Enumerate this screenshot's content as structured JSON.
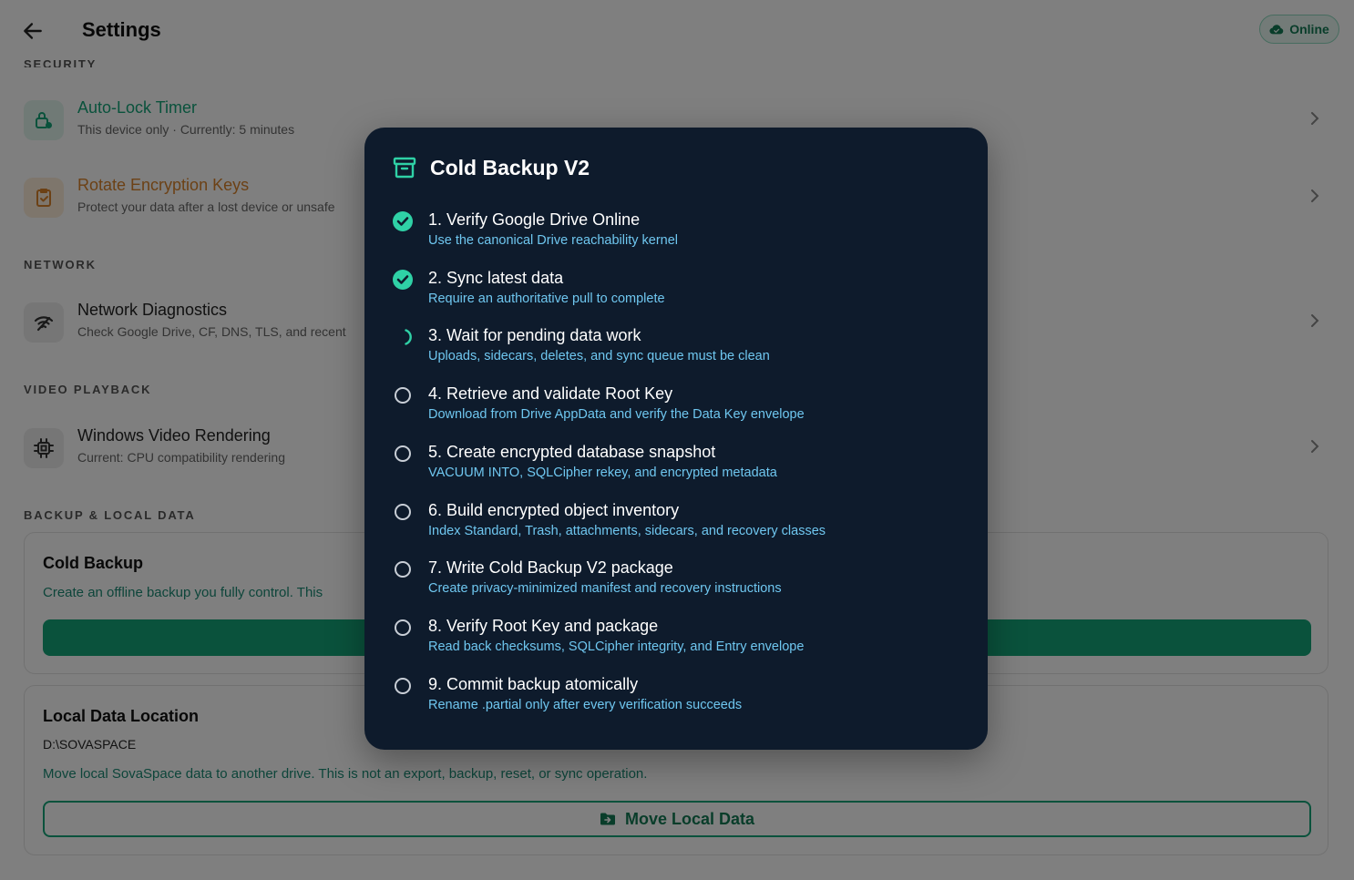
{
  "header": {
    "title": "Settings",
    "status": "Online"
  },
  "sections": {
    "security": "SECURITY",
    "network": "NETWORK",
    "video": "VIDEO PLAYBACK",
    "backup": "BACKUP & LOCAL DATA"
  },
  "rows": {
    "auto_lock": {
      "title": "Auto-Lock Timer",
      "subtitle": "This device only · Currently: 5 minutes"
    },
    "rotate_keys": {
      "title": "Rotate Encryption Keys",
      "subtitle": "Protect your data after a lost device or unsafe"
    },
    "network_diag": {
      "title": "Network Diagnostics",
      "subtitle": "Check Google Drive, CF, DNS, TLS, and recent"
    },
    "video": {
      "title": "Windows Video Rendering",
      "subtitle": "Current: CPU compatibility rendering"
    }
  },
  "cold_backup_card": {
    "title": "Cold Backup",
    "description": "Create an offline backup you fully control. This"
  },
  "local_data_card": {
    "title": "Local Data Location",
    "path": "D:\\SOVASPACE",
    "description": "Move local SovaSpace data to another drive. This is not an export, backup, reset, or sync operation.",
    "button": "Move Local Data"
  },
  "modal": {
    "title": "Cold Backup V2",
    "steps": [
      {
        "title": "1. Verify Google Drive Online",
        "subtitle": "Use the canonical Drive reachability kernel",
        "status": "done"
      },
      {
        "title": "2. Sync latest data",
        "subtitle": "Require an authoritative pull to complete",
        "status": "done"
      },
      {
        "title": "3. Wait for pending data work",
        "subtitle": "Uploads, sidecars, deletes, and sync queue must be clean",
        "status": "in-progress"
      },
      {
        "title": "4. Retrieve and validate Root Key",
        "subtitle": "Download from Drive AppData and verify the Data Key envelope",
        "status": "pending"
      },
      {
        "title": "5. Create encrypted database snapshot",
        "subtitle": "VACUUM INTO, SQLCipher rekey, and encrypted metadata",
        "status": "pending"
      },
      {
        "title": "6. Build encrypted object inventory",
        "subtitle": "Index Standard, Trash, attachments, sidecars, and recovery classes",
        "status": "pending"
      },
      {
        "title": "7. Write Cold Backup V2 package",
        "subtitle": "Create privacy-minimized manifest and recovery instructions",
        "status": "pending"
      },
      {
        "title": "8. Verify Root Key and package",
        "subtitle": "Read back checksums, SQLCipher integrity, and Entry envelope",
        "status": "pending"
      },
      {
        "title": "9. Commit backup atomically",
        "subtitle": "Rename .partial only after every verification succeeds",
        "status": "pending"
      }
    ]
  },
  "colors": {
    "accent": "#14a579",
    "modal_bg": "#0e1b2c",
    "step_done": "#2fd1a6",
    "step_subtitle": "#6fc7f0",
    "warning": "#d9822b"
  },
  "icons": {
    "back": "arrow-left-icon",
    "status": "cloud-check-icon",
    "auto_lock": "lock-clock-icon",
    "rotate_keys": "clipboard-check-icon",
    "network": "wifi-icon",
    "video": "chip-icon",
    "chevron": "chevron-right-icon",
    "modal": "archive-icon",
    "move_data": "folder-arrow-icon"
  }
}
